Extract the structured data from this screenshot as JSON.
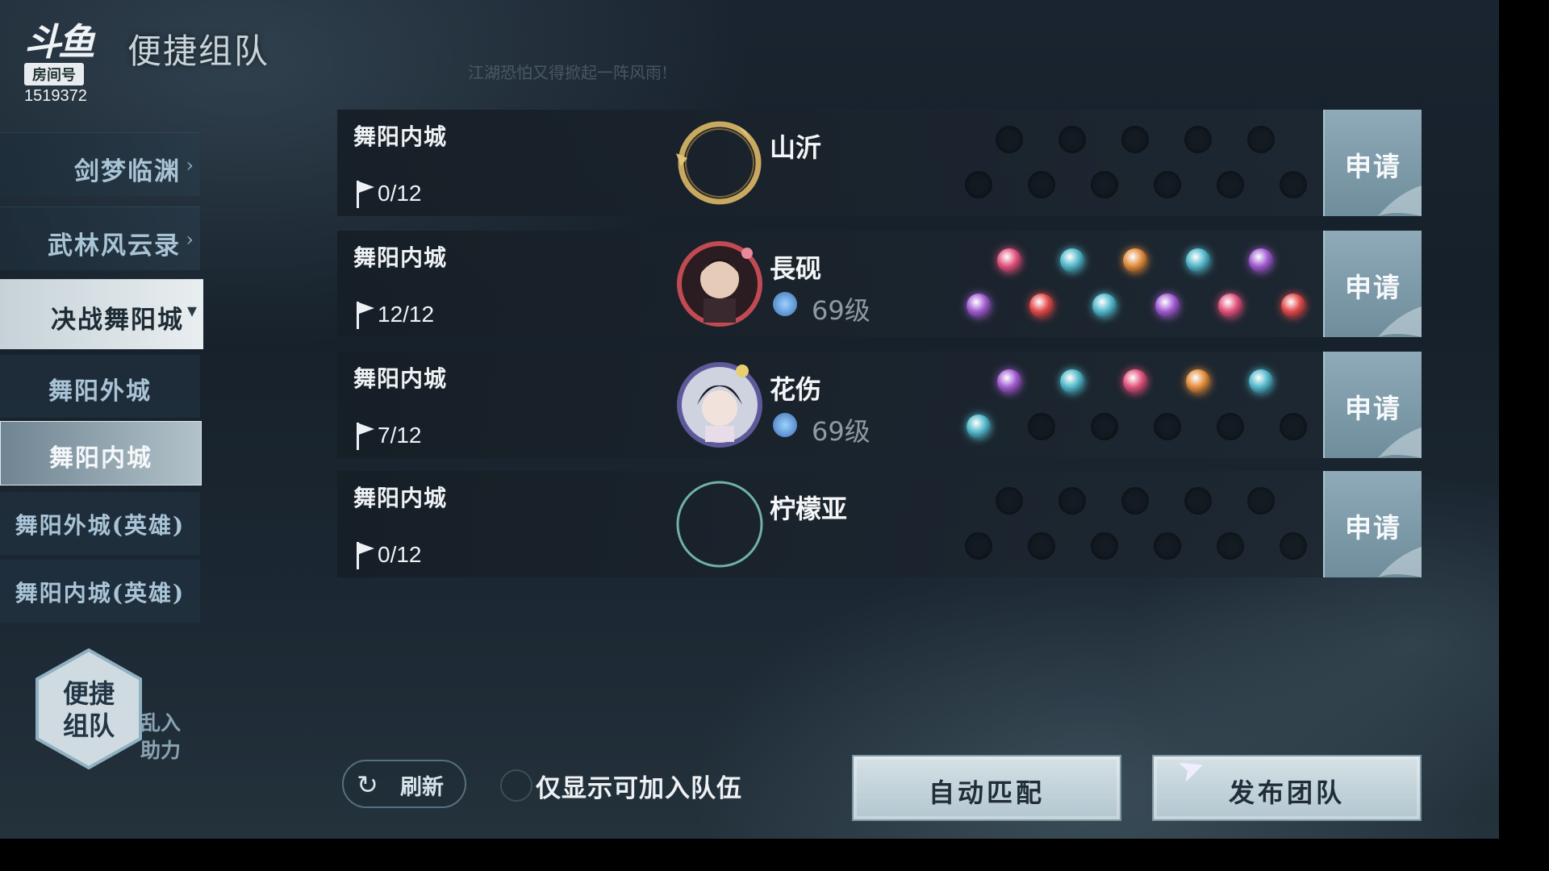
{
  "logo": {
    "brand": "斗鱼",
    "tag": "房间号",
    "room_number": "1519372"
  },
  "header": {
    "title": "便捷组队",
    "subtitle": "江湖恐怕又得掀起一阵风雨!"
  },
  "sidebar": {
    "items": [
      {
        "label": "剑梦临渊",
        "arrow": "›"
      },
      {
        "label": "武林风云录",
        "arrow": "›"
      },
      {
        "label": "决战舞阳城",
        "arrow": "▾"
      }
    ],
    "sub_items": [
      {
        "label": "舞阳外城"
      },
      {
        "label": "舞阳内城"
      },
      {
        "label": "舞阳外城(英雄)"
      },
      {
        "label": "舞阳内城(英雄)"
      }
    ]
  },
  "mode_tabs": {
    "main": "便捷组队",
    "main_line1": "便捷",
    "main_line2": "组队",
    "side_line1": "乱入",
    "side_line2": "助力"
  },
  "teams": [
    {
      "area": "舞阳内城",
      "count": "0/12",
      "leader": "山沂",
      "level": "",
      "filled_slots": [],
      "avatar": "gold-ring-frame"
    },
    {
      "area": "舞阳内城",
      "count": "12/12",
      "leader": "長砚",
      "level": "69级",
      "avatar": "male-portrait",
      "filled_slots": [
        "#e0507a",
        "#4fb6c8",
        "#e08a3a",
        "#4fb6c8",
        "#a05ad0",
        "#a05ad0",
        "#e04848",
        "#4fb6c8",
        "#a05ad0",
        "#e0507a",
        "#e04848"
      ]
    },
    {
      "area": "舞阳内城",
      "count": "7/12",
      "leader": "花伤",
      "level": "69级",
      "avatar": "female-portrait",
      "filled_slots": [
        "#a05ad0",
        "#4fb6c8",
        "#e0507a",
        "#e08a3a",
        "#4fb6c8",
        "#4fb6c8"
      ]
    },
    {
      "area": "舞阳内城",
      "count": "0/12",
      "leader": "柠檬亚",
      "level": "",
      "filled_slots": [],
      "avatar": "empty-ring"
    }
  ],
  "apply_label": "申请",
  "footer": {
    "refresh_label": "刷新",
    "filter_label": "仅显示可加入队伍",
    "auto_match_label": "自动匹配",
    "publish_label": "发布团队"
  },
  "colors": {
    "accent": "#6f8d9c",
    "background": "#1a2430",
    "sidebar_active": "#dfe7eb"
  }
}
